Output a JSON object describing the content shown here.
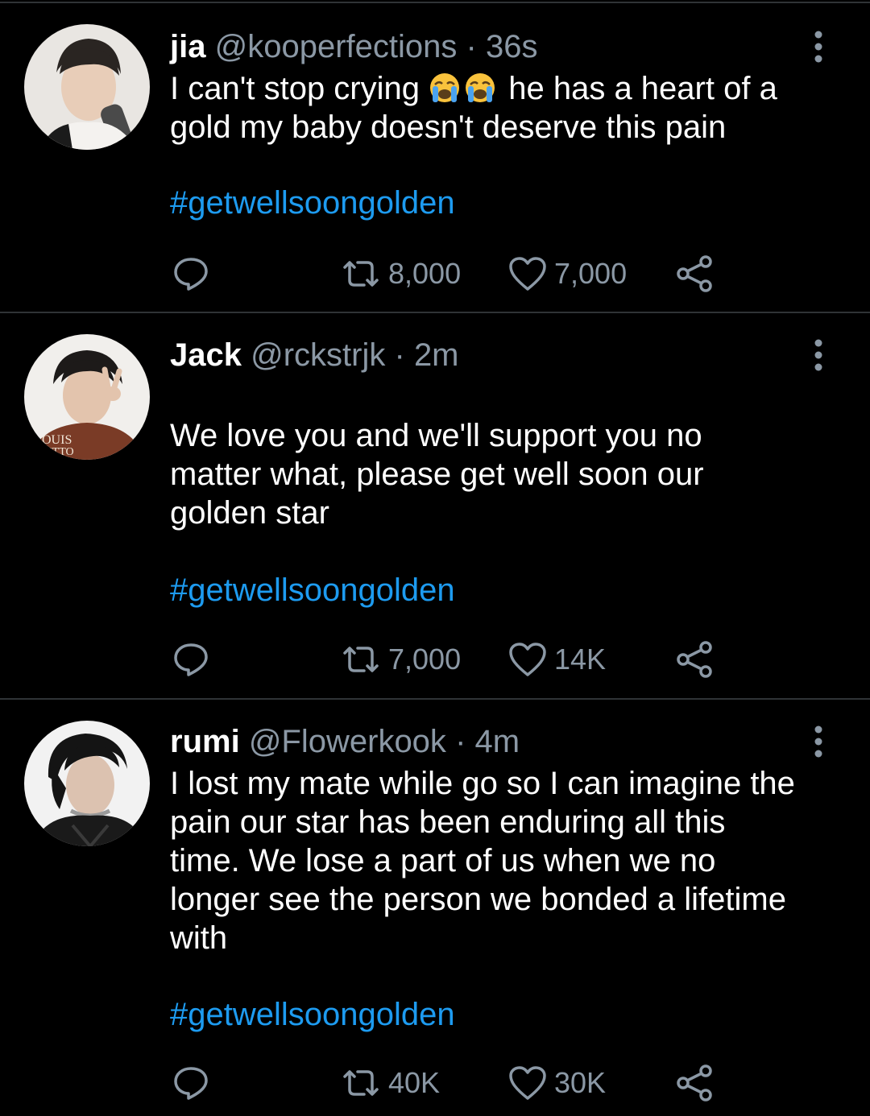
{
  "theme": {
    "background": "#000000",
    "divider": "#2f3336",
    "text_primary": "#ffffff",
    "text_secondary": "#8b98a5",
    "link": "#1d9bf0"
  },
  "tweets": [
    {
      "name": "jia",
      "handle": "@kooperfections",
      "separator": "·",
      "time": "36s",
      "text_before_emoji": "I can't stop crying ",
      "emojis": [
        "loudly-crying-face",
        "loudly-crying-face"
      ],
      "text_after_emoji": " he has a heart of a\ngold my baby doesn't deserve this pain",
      "hashtag": "#getwellsoongolden",
      "retweets": "8,000",
      "likes": "7,000"
    },
    {
      "name": "Jack",
      "handle": "@rckstrjk",
      "separator": "·",
      "time": "2m",
      "text": "We love you and we'll support you no\nmatter what, please get well soon our\ngolden star",
      "hashtag": "#getwellsoongolden",
      "retweets": "7,000",
      "likes": "14K"
    },
    {
      "name": "rumi",
      "handle": "@Flowerkook",
      "separator": "·",
      "time": "4m",
      "text": "I lost my mate while go so I can imagine the\npain our star has been enduring all this\ntime. We lose a part of us when we no\nlonger see the person we bonded a lifetime\nwith",
      "hashtag": "#getwellsoongolden",
      "retweets": "40K",
      "likes": "30K"
    }
  ],
  "icons": {
    "reply": "reply-icon",
    "retweet": "retweet-icon",
    "like": "heart-icon",
    "share": "share-icon",
    "more": "more-vertical-icon"
  }
}
